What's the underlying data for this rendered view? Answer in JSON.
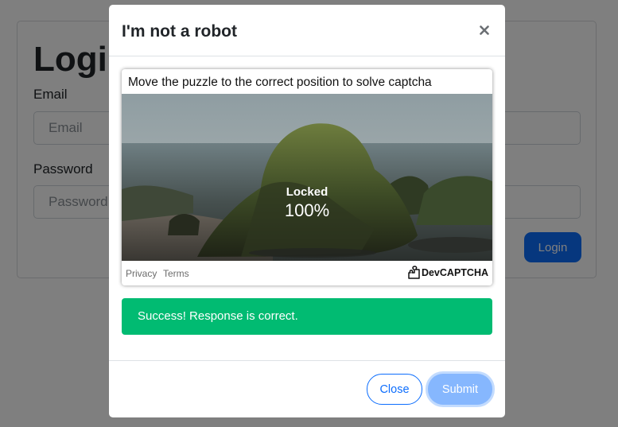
{
  "login": {
    "title": "Login",
    "email_label": "Email",
    "email_placeholder": "Email",
    "password_label": "Password",
    "password_placeholder": "Password",
    "login_button": "Login"
  },
  "modal": {
    "title": "I'm not a robot",
    "close_icon": "close-icon",
    "captcha": {
      "instruction": "Move the puzzle to the correct position to solve captcha",
      "status": "Locked",
      "progress_text": "100%",
      "privacy_link": "Privacy",
      "terms_link": "Terms",
      "brand": "DevCAPTCHA",
      "brand_icon": "puzzle-piece-icon"
    },
    "alert": "Success! Response is correct.",
    "buttons": {
      "close": "Close",
      "submit": "Submit"
    }
  },
  "colors": {
    "primary": "#0d6efd",
    "success": "#01bb72",
    "submit_disabled": "#86b7fe",
    "backdrop": "rgba(0,0,0,0.5)"
  }
}
